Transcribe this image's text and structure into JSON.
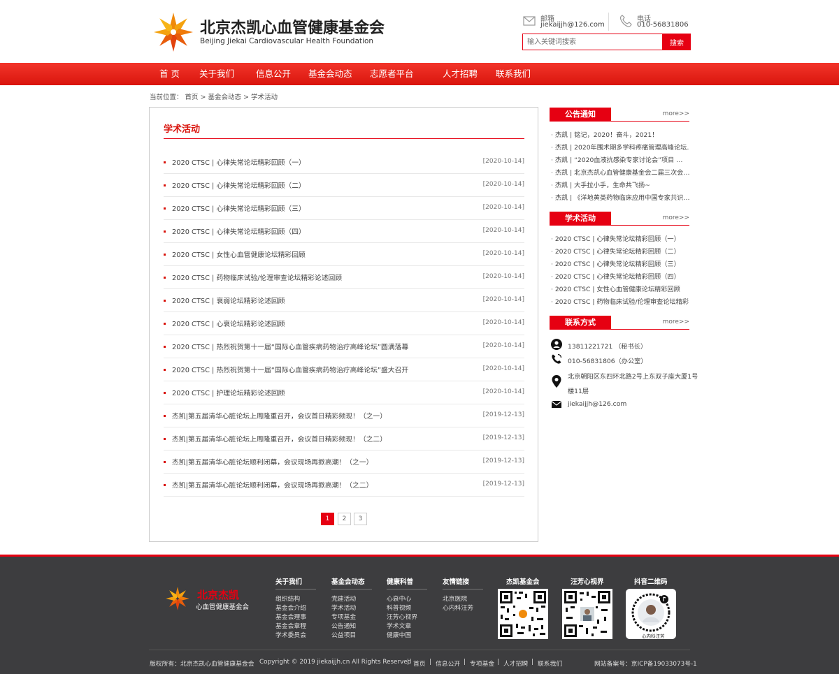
{
  "header": {
    "logo_cn": "北京杰凯心血管健康基金会",
    "logo_en": "Beijing Jiekai Cardiovascular Health Foundation",
    "email_label": "邮箱",
    "email_value": "jiekaijjh@126.com",
    "phone_label": "电话",
    "phone_value": "010-56831806",
    "search_placeholder": "输入关键词搜索",
    "search_button": "搜索"
  },
  "nav": [
    "首 页",
    "关于我们",
    "信息公开",
    "基金会动态",
    "志愿者平台",
    "人才招聘",
    "联系我们"
  ],
  "breadcrumb": "当前位置： 首页 > 基金会动态 > 学术活动",
  "main": {
    "title": "学术活动",
    "items": [
      {
        "title": "2020 CTSC | 心律失常论坛精彩回顾（一）",
        "date": "[2020-10-14]"
      },
      {
        "title": "2020 CTSC | 心律失常论坛精彩回顾（二）",
        "date": "[2020-10-14]"
      },
      {
        "title": "2020 CTSC | 心律失常论坛精彩回顾（三）",
        "date": "[2020-10-14]"
      },
      {
        "title": "2020 CTSC | 心律失常论坛精彩回顾（四）",
        "date": "[2020-10-14]"
      },
      {
        "title": "2020 CTSC | 女性心血管健康论坛精彩回顾",
        "date": "[2020-10-14]"
      },
      {
        "title": "2020 CTSC | 药物临床试验/伦理审查论坛精彩论述回顾",
        "date": "[2020-10-14]"
      },
      {
        "title": "2020 CTSC | 衰弱论坛精彩论述回顾",
        "date": "[2020-10-14]"
      },
      {
        "title": "2020 CTSC | 心衰论坛精彩论述回顾",
        "date": "[2020-10-14]"
      },
      {
        "title": "2020 CTSC | 热烈祝贺第十一届“国际心血管疾病药物治疗高峰论坛”圆满落幕",
        "date": "[2020-10-14]"
      },
      {
        "title": "2020 CTSC | 热烈祝贺第十一届“国际心血管疾病药物治疗高峰论坛”盛大召开",
        "date": "[2020-10-14]"
      },
      {
        "title": "2020 CTSC | 护理论坛精彩论述回顾",
        "date": "[2020-10-14]"
      },
      {
        "title": "杰凯|第五届清华心脏论坛上周隆重召开，会议首日精彩频现！（之一）",
        "date": "[2019-12-13]"
      },
      {
        "title": "杰凯|第五届清华心脏论坛上周隆重召开，会议首日精彩频现！（之二）",
        "date": "[2019-12-13]"
      },
      {
        "title": "杰凯|第五届清华心脏论坛顺利闭幕，会议现场再掀高潮！（之一）",
        "date": "[2019-12-13]"
      },
      {
        "title": "杰凯|第五届清华心脏论坛顺利闭幕，会议现场再掀高潮！（之二）",
        "date": "[2019-12-13]"
      }
    ],
    "pages": [
      "1",
      "2",
      "3"
    ]
  },
  "sidebar": {
    "more": "more>>",
    "notice_title": "公告通知",
    "notice_items": [
      "· 杰凯 | 铭记，2020！奋斗，2021！",
      "· 杰凯 | 2020年围术期多学科疼痛管理高峰论坛…",
      "· 杰凯 | “2020血液抗感染专家讨论会”项目 …",
      "· 杰凯 | 北京杰凯心血管健康基金会二届三次会…",
      "· 杰凯 | 大手拉小手，生命共飞扬~",
      "· 杰凯 | 《洋地黄类药物临床应用中国专家共识…"
    ],
    "academic_title": "学术活动",
    "academic_items": [
      "· 2020 CTSC | 心律失常论坛精彩回顾（一）",
      "· 2020 CTSC | 心律失常论坛精彩回顾（二）",
      "· 2020 CTSC | 心律失常论坛精彩回顾（三）",
      "· 2020 CTSC | 心律失常论坛精彩回顾（四）",
      "· 2020 CTSC | 女性心血管健康论坛精彩回顾",
      "· 2020 CTSC | 药物临床试验/伦理审查论坛精彩…"
    ],
    "contact_title": "联系方式",
    "contact": {
      "mobile": "13811221721 （秘书长）",
      "phone": "010-56831806（办公室）",
      "address_1": "北京朝阳区东四环北路2号上东双子座大厦1号",
      "address_2": "楼11层",
      "email": "jiekaijjh@126.com"
    }
  },
  "footer": {
    "logo_cn": "北京杰凯",
    "logo_sub": "心血管健康基金会",
    "columns": [
      {
        "title": "关于我们",
        "links": [
          "组织结构",
          "基金会介绍",
          "基金会理事",
          "基金会章程",
          "学术委员会"
        ]
      },
      {
        "title": "基金会动态",
        "links": [
          "党建活动",
          "学术活动",
          "专项基金",
          "公告通知",
          "公益项目"
        ]
      },
      {
        "title": "健康科普",
        "links": [
          "心衰中心",
          "科普视频",
          "汪芳心视界",
          "学术文章",
          "健康中国"
        ]
      },
      {
        "title": "友情链接",
        "links": [
          "北京医院",
          "心内科汪芳"
        ]
      }
    ],
    "qr_titles": [
      "杰凯基金会",
      "汪芳心视界",
      "抖音二维码"
    ],
    "qr_caption": "心内科汪芳",
    "copyright_owner": "版权所有：北京杰凯心血管健康基金会",
    "copyright": "Copyright © 2019 jiekaijjh.cn All Rights Reserved",
    "bottom_links": [
      "首页",
      "信息公开",
      "专项基金",
      "人才招聘",
      "联系我们"
    ],
    "icp": "网站备案号：京ICP备19033073号-1"
  },
  "colors": {
    "accent": "#e60012",
    "footer_bg": "#3d3d3f"
  }
}
